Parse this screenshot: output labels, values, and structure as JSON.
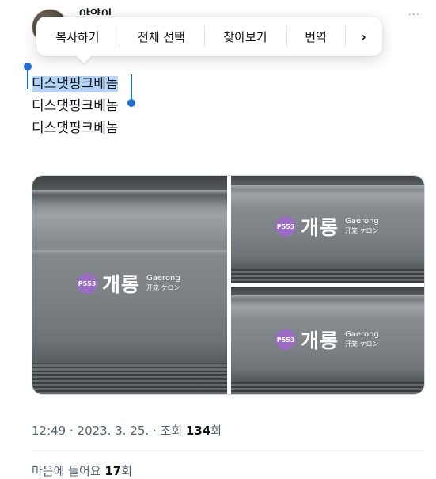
{
  "header": {
    "username_partial": "야약이",
    "more_glyph": "···"
  },
  "context_menu": {
    "items": [
      {
        "label": "복사하기"
      },
      {
        "label": "전체 선택"
      },
      {
        "label": "찾아보기"
      },
      {
        "label": "번역"
      },
      {
        "label": "›"
      }
    ]
  },
  "tweet": {
    "lines": [
      "디스댓핑크베놈",
      "디스댓핑크베놈",
      "디스댓핑크베놈"
    ],
    "images": [
      {
        "line_badge": "P553",
        "station_ko": "개롱",
        "station_en": "Gaerong",
        "station_zh": "开笼",
        "station_jp": "ケロン"
      },
      {
        "line_badge": "P553",
        "station_ko": "개롱",
        "station_en": "Gaerong",
        "station_zh": "开笼",
        "station_jp": "ケロン"
      },
      {
        "line_badge": "P553",
        "station_ko": "개롱",
        "station_en": "Gaerong",
        "station_zh": "开笼",
        "station_jp": "ケロン"
      }
    ],
    "meta": {
      "time": "12:49",
      "sep1": " · ",
      "date": "2023. 3. 25.",
      "sep2": " · ",
      "views_prefix": "조회 ",
      "views": "134",
      "views_suffix": "회"
    },
    "likes": {
      "prefix": "마음에 들어요 ",
      "count": "17",
      "suffix": "회"
    }
  },
  "colors": {
    "selection": "#b4d4f6",
    "selection_handle": "#1d6fd6",
    "line_badge": "#9b6cc4",
    "secondary_text": "#536471"
  }
}
